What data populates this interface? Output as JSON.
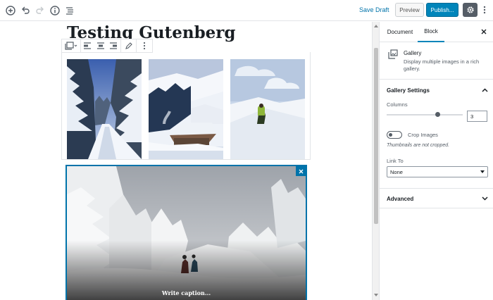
{
  "toolbar": {
    "save_draft": "Save Draft",
    "preview": "Preview",
    "publish": "Publish...",
    "icons": [
      "add-block-icon",
      "undo-icon",
      "redo-icon",
      "info-icon",
      "outline-icon",
      "gear-icon",
      "more-vertical-icon"
    ]
  },
  "post": {
    "title": "Testing Gutenberg"
  },
  "gallery": {
    "thumbs": [
      "forest-trail-thumbnail",
      "snowy-village-thumbnail",
      "hiker-snowfield-thumbnail"
    ],
    "featured": "snowy-hikers-image",
    "caption_placeholder": "Write caption..."
  },
  "sidebar": {
    "tabs": [
      "Document",
      "Block"
    ],
    "active_tab": "Block",
    "block_title": "Gallery",
    "block_desc": "Display multiple images in a rich gallery.",
    "settings_title": "Gallery Settings",
    "columns_label": "Columns",
    "columns_value": "3",
    "crop_label": "Crop Images",
    "crop_help": "Thumbnails are not cropped.",
    "link_label": "Link To",
    "link_value": "None",
    "advanced_title": "Advanced"
  },
  "colors": {
    "accent": "#0085ba",
    "selection": "#0073aa",
    "text": "#191e23",
    "muted": "#555d66",
    "border": "#e2e4e7"
  }
}
